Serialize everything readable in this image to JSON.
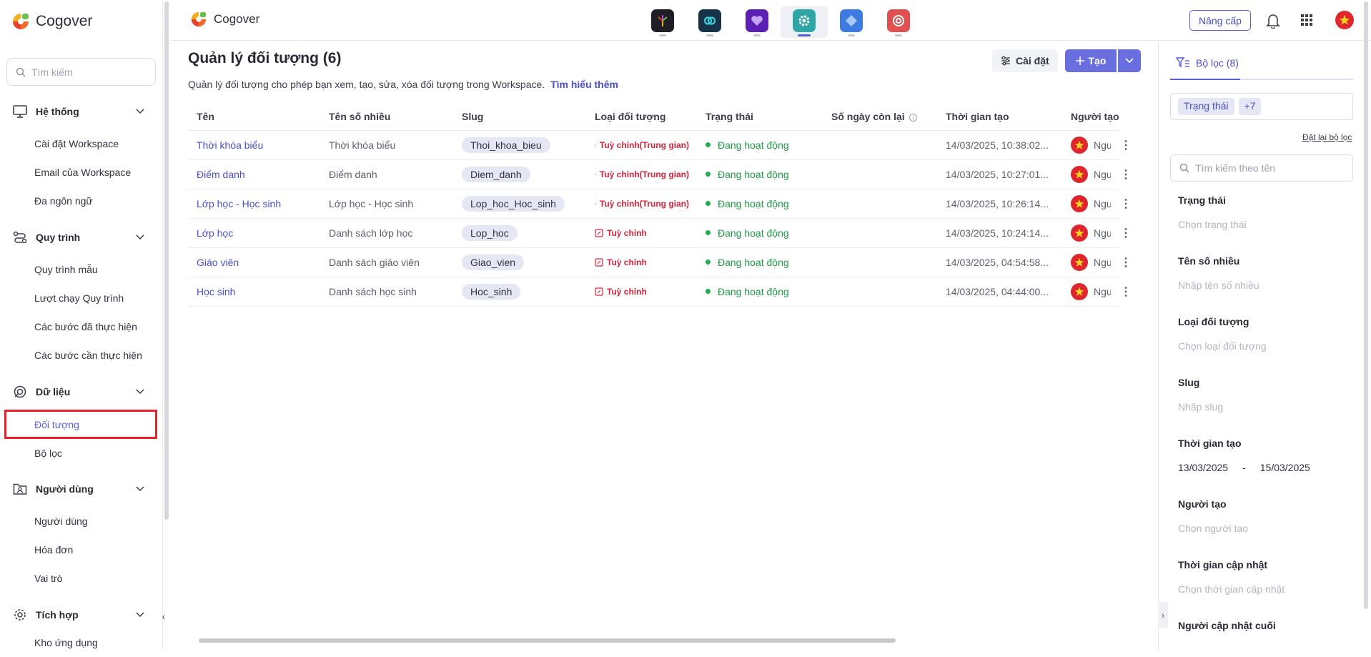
{
  "brand": {
    "name": "Cogover"
  },
  "sidebar": {
    "search_placeholder": "Tìm kiếm",
    "groups": [
      {
        "title": "Hệ thống",
        "items": [
          "Cài đặt Workspace",
          "Email của Workspace",
          "Đa ngôn ngữ"
        ]
      },
      {
        "title": "Quy trình",
        "items": [
          "Quy trình mẫu",
          "Lượt chạy Quy trình",
          "Các bước đã thực hiện",
          "Các bước cần thực hiện"
        ]
      },
      {
        "title": "Dữ liệu",
        "items": [
          "Đối tượng",
          "Bộ lọc"
        ]
      },
      {
        "title": "Người dùng",
        "items": [
          "Người dùng",
          "Hóa đơn",
          "Vai trò"
        ]
      },
      {
        "title": "Tích hợp",
        "items": [
          "Kho ứng dụng"
        ]
      }
    ],
    "active_item": "Đối tượng"
  },
  "topbar": {
    "title": "Cogover",
    "apps": [
      {
        "icon": "tree-app-icon",
        "color": "#1e1e24"
      },
      {
        "icon": "link-app-icon",
        "color": "#17334a"
      },
      {
        "icon": "heart-app-icon",
        "color": "#5b1fb3"
      },
      {
        "icon": "settings-app-icon",
        "color": "#2ea6a6",
        "selected": true
      },
      {
        "icon": "diamond-app-icon",
        "color": "#3d7be0"
      },
      {
        "icon": "target-app-icon",
        "color": "#e05050"
      }
    ],
    "upgrade_label": "Nâng cấp"
  },
  "main": {
    "title": "Quản lý đối tượng (6)",
    "description": "Quản lý đối tượng cho phép bạn xem, tạo, sửa, xóa đối tượng trong Workspace.",
    "learn_more": "Tìm hiểu thêm",
    "settings_label": "Cài đặt",
    "create_label": "Tạo",
    "columns": [
      "Tên",
      "Tên số nhiều",
      "Slug",
      "Loại đối tượng",
      "Trạng thái",
      "Số ngày còn lại",
      "Thời gian tạo",
      "Người tạo"
    ],
    "rows": [
      {
        "name": "Thời khóa biểu",
        "plural": "Thời khóa biểu",
        "slug": "Thoi_khoa_bieu",
        "type": "Tuỳ chỉnh(Trung gian)",
        "status": "Đang hoạt động",
        "days_left": "",
        "created": "14/03/2025, 10:38:02...",
        "creator": "Người"
      },
      {
        "name": "Điểm danh",
        "plural": "Điểm danh",
        "slug": "Diem_danh",
        "type": "Tuỳ chỉnh(Trung gian)",
        "status": "Đang hoạt động",
        "days_left": "",
        "created": "14/03/2025, 10:27:01...",
        "creator": "Người"
      },
      {
        "name": "Lớp học - Học sinh",
        "plural": "Lớp học - Học sinh",
        "slug": "Lop_hoc_Hoc_sinh",
        "type": "Tuỳ chỉnh(Trung gian)",
        "status": "Đang hoạt động",
        "days_left": "",
        "created": "14/03/2025, 10:26:14...",
        "creator": "Người"
      },
      {
        "name": "Lớp học",
        "plural": "Danh sách lớp học",
        "slug": "Lop_hoc",
        "type": "Tuỳ chỉnh",
        "status": "Đang hoạt động",
        "days_left": "",
        "created": "14/03/2025, 10:24:14...",
        "creator": "Người"
      },
      {
        "name": "Giáo viên",
        "plural": "Danh sách giáo viên",
        "slug": "Giao_vien",
        "type": "Tuỳ chỉnh",
        "status": "Đang hoạt động",
        "days_left": "",
        "created": "14/03/2025, 04:54:58...",
        "creator": "Người"
      },
      {
        "name": "Học sinh",
        "plural": "Danh sách học sinh",
        "slug": "Hoc_sinh",
        "type": "Tuỳ chỉnh",
        "status": "Đang hoạt động",
        "days_left": "",
        "created": "14/03/2025, 04:44:00...",
        "creator": "Người"
      }
    ],
    "status_color": "#1fae50",
    "type_color": "#d6223a",
    "accent": "#5a5fd6"
  },
  "filter": {
    "tab_label": "Bộ lọc (8)",
    "chips": [
      "Trạng thái",
      "+7"
    ],
    "reset_label": "Đặt lại bộ lọc",
    "search_placeholder": "Tìm kiếm theo tên",
    "fields": [
      {
        "label": "Trạng thái",
        "placeholder": "Chọn trạng thái"
      },
      {
        "label": "Tên số nhiều",
        "placeholder": "Nhập tên số nhiều"
      },
      {
        "label": "Loại đối tượng",
        "placeholder": "Chọn loại đối tượng"
      },
      {
        "label": "Slug",
        "placeholder": "Nhập slug"
      },
      {
        "label": "Thời gian tạo",
        "date_from": "13/03/2025",
        "date_sep": "-",
        "date_to": "15/03/2025"
      },
      {
        "label": "Người tạo",
        "placeholder": "Chọn người tạo"
      },
      {
        "label": "Thời gian cập nhật",
        "placeholder": "Chọn thời gian cập nhật"
      },
      {
        "label": "Người cập nhật cuối"
      }
    ]
  }
}
